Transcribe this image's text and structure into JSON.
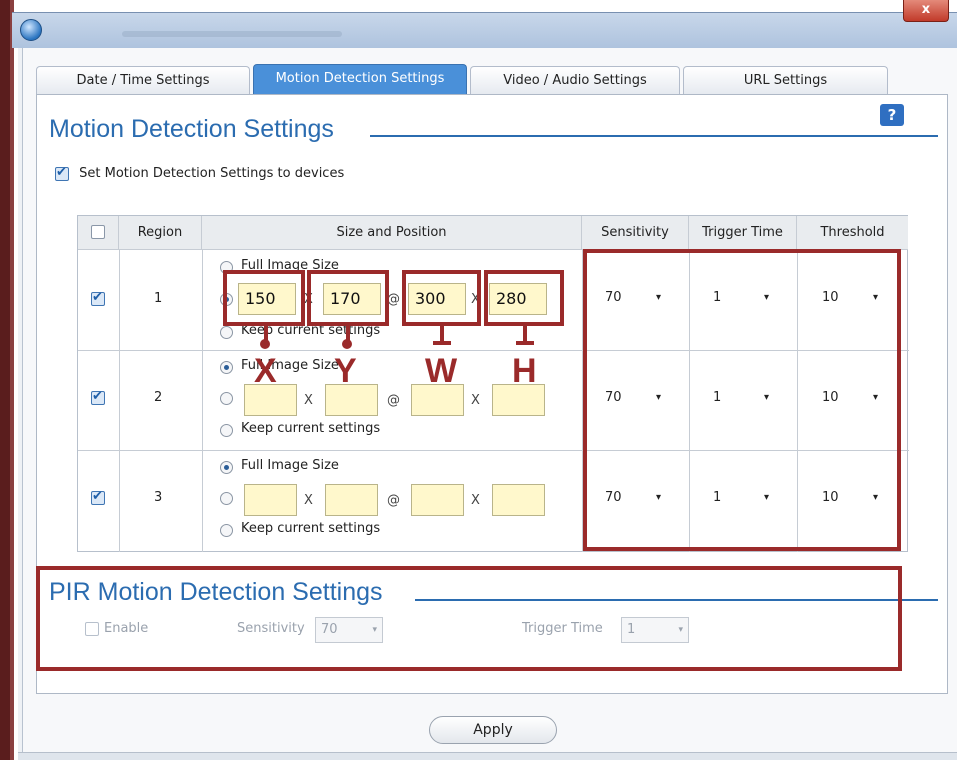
{
  "window": {
    "close_label": "x"
  },
  "tabs": [
    {
      "label": "Date / Time Settings"
    },
    {
      "label": "Motion Detection Settings"
    },
    {
      "label": "Video / Audio Settings"
    },
    {
      "label": "URL Settings"
    }
  ],
  "motion": {
    "title": "Motion Detection Settings",
    "help": "?",
    "set_devices_label": "Set Motion Detection Settings to devices",
    "set_devices_checked": true
  },
  "table": {
    "headers": [
      "Region",
      "Size and Position",
      "Sensitivity",
      "Trigger Time",
      "Threshold"
    ],
    "rows": [
      {
        "region": "1",
        "selected": "custom",
        "x": "150",
        "y": "170",
        "w": "300",
        "h": "280",
        "sensitivity": "70",
        "trigger": "1",
        "threshold": "10"
      },
      {
        "region": "2",
        "selected": "full",
        "x": "",
        "y": "",
        "w": "",
        "h": "",
        "sensitivity": "70",
        "trigger": "1",
        "threshold": "10"
      },
      {
        "region": "3",
        "selected": "full",
        "x": "",
        "y": "",
        "w": "",
        "h": "",
        "sensitivity": "70",
        "trigger": "1",
        "threshold": "10"
      }
    ],
    "full_image_label": "Full Image Size",
    "keep_label": "Keep current settings",
    "sep_x": "X",
    "sep_at": "@",
    "dropdown_arrow": "▾"
  },
  "annotations": {
    "x": "X",
    "y": "Y",
    "w": "W",
    "h": "H"
  },
  "pir": {
    "title": "PIR Motion Detection Settings",
    "enable_label": "Enable",
    "sensitivity_label": "Sensitivity",
    "sensitivity_value": "70",
    "trigger_label": "Trigger Time",
    "trigger_value": "1"
  },
  "apply_label": "Apply"
}
